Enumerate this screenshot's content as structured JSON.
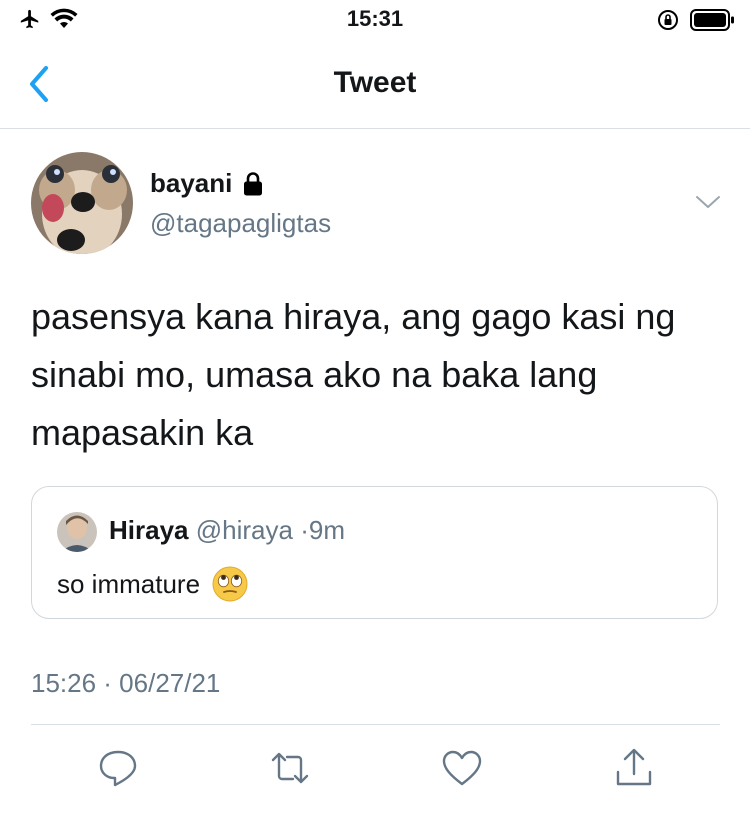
{
  "status_bar": {
    "time": "15:31",
    "left_icons": [
      "airplane-icon",
      "wifi-icon"
    ],
    "right_icons": [
      "orientation-lock-icon",
      "battery-icon"
    ]
  },
  "nav": {
    "back_icon": "chevron-left-icon",
    "title": "Tweet"
  },
  "tweet": {
    "author_name": "bayani",
    "author_handle": "@tagapagligtas",
    "protected_icon": "lock-icon",
    "text": "pasensya kana hiraya, ang gago kasi ng sinabi mo, umasa ako na baka lang mapasakin ka",
    "timestamp": "15:26 · 06/27/21",
    "menu_icon": "chevron-down-icon"
  },
  "quoted_tweet": {
    "author_name": "Hiraya",
    "author_handle": "@hiraya",
    "separator": "·",
    "time_ago": "9m",
    "text": "so immature",
    "emoji": "🙄"
  },
  "actions": [
    "reply-icon",
    "retweet-icon",
    "like-icon",
    "share-icon"
  ],
  "colors": {
    "accent": "#1da1f2",
    "text_primary": "#14171a",
    "text_secondary": "#657786",
    "divider": "#d9dfe3"
  }
}
